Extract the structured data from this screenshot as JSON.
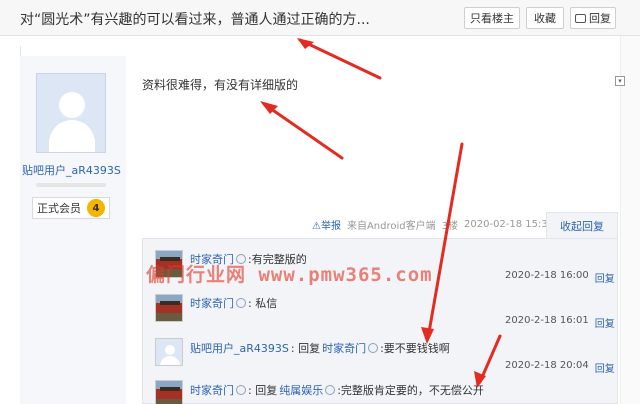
{
  "header": {
    "title": "对“圆光术”有兴趣的可以看过来，普通人通过正确的方...",
    "only_op_label": "只看楼主",
    "favorite_label": "收藏",
    "reply_label": "回复"
  },
  "author": {
    "name": "贴吧用户_aR4393S",
    "badge_label": "正式会员",
    "level": "4"
  },
  "post": {
    "content": "资料很难得，有没有详细版的",
    "report_label": "举报",
    "client_label": "来自Android客户端",
    "floor": "3楼",
    "time": "2020-02-18 15:39",
    "collapse_label": "收起回复"
  },
  "replies": [
    {
      "user": "时家奇门",
      "text": ":有完整版的",
      "time": "2020-2-18 16:00",
      "reply_label": "回复"
    },
    {
      "user": "时家奇门",
      "text": ": 私信",
      "time": "2020-2-18 16:01",
      "reply_label": "回复"
    },
    {
      "user": "贴吧用户_aR4393S",
      "prefix": ": 回复",
      "target": "时家奇门",
      "text": ":要不要钱钱啊",
      "time": "2020-2-18 20:04",
      "reply_label": "回复"
    },
    {
      "user": "时家奇门",
      "prefix": ": 回复",
      "target": "纯属娱乐",
      "text": ":完整版肯定要的，不无偿公开"
    }
  ],
  "watermark": "偏门行业网 www.pmw365.com",
  "colors": {
    "link": "#2d64b3",
    "annotation_arrow": "#e32b22",
    "level_badge": "#f4b400"
  }
}
